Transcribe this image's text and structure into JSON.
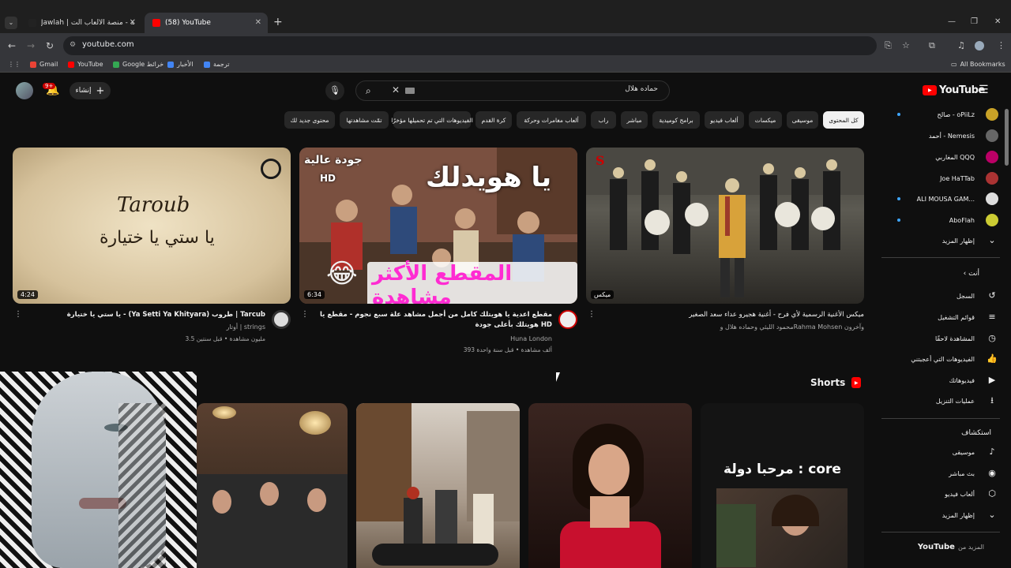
{
  "browser": {
    "tabs": [
      {
        "title": "Jawlah | جولة - منصة الألعاب الت...",
        "active": false
      },
      {
        "title": "(58) YouTube",
        "active": true
      }
    ],
    "url": "youtube.com",
    "bookmarks": [
      {
        "label": "Gmail",
        "color": "#ea4335"
      },
      {
        "label": "YouTube",
        "color": "#ff0000"
      },
      {
        "label": "Google خرائط",
        "color": "#34a853"
      },
      {
        "label": "الأخبار",
        "color": "#4285f4"
      },
      {
        "label": "ترجمة",
        "color": "#4285f4"
      }
    ],
    "all_bookmarks": "All Bookmarks"
  },
  "masthead": {
    "notification_count": "9+",
    "create_label": "إنشاء",
    "search_value": "حماده هلال",
    "logo_text": "YouTube"
  },
  "chips": [
    "كل المحتوى",
    "موسيقى",
    "ميكسات",
    "ألعاب فيديو",
    "برامج كوميدية",
    "مباشر",
    "راب",
    "ألعاب مغامرات وحركة",
    "كرة القدم",
    "الفيديوهات التي تم تحميلها مؤخرًا",
    "تمّت مشاهدتها",
    "محتوى جديد لك"
  ],
  "videos": [
    {
      "title": "ميكس الأغنية الرسمية لأي فرح - أغنية هجيرو عداء سعد الصغير",
      "channel": "محمود الليثي وحماده هلال وRahma Mohsen وآخرون",
      "meta": "",
      "duration": "ميكس",
      "thumb_caption": ""
    },
    {
      "title": "مقطع اعدية يا هويتلك كامل من أجمل مشاهد علة سبع نجوم - مقطع يا هويتلك بأعلى جودة HD",
      "channel": "Huna London",
      "meta": "393 ألف مشاهدة • قبل سنة واحدة",
      "duration": "6:34",
      "thumb_caption_top": "جودة عالية",
      "thumb_caption_hd": "HD",
      "thumb_caption_main": "يا هويدلك",
      "thumb_caption_bottom": "المقطع الأكثر مشاهدة"
    },
    {
      "title": "يا ستي يا ختيارة - (Ya Setti Ya Khityara) طروب | Tarcub",
      "channel": "أوتار | strings",
      "meta": "3.5 مليون مشاهدة • قبل سنتين",
      "duration": "4:24",
      "thumb_caption_script": "Taroub",
      "thumb_caption_arabic": "يا ستي يا ختيارة"
    }
  ],
  "shorts": {
    "heading": "Shorts",
    "items": [
      {
        "caption_top": "مرحبا دولة : core"
      },
      {
        "caption_top": ""
      },
      {
        "caption_top": ""
      },
      {
        "caption_top": ""
      }
    ]
  },
  "sidebar": {
    "subscriptions": [
      {
        "label": "صالح - oPiiLz",
        "live": true,
        "color": "#c9a227"
      },
      {
        "label": "أحمد - Nemesis",
        "live": false,
        "color": "#888"
      },
      {
        "label": "المغاربي QQQ",
        "live": false,
        "color": "#b06"
      },
      {
        "label": "Joe HaTTab",
        "live": false,
        "color": "#a33"
      },
      {
        "label": "ALI MOUSA GAM...",
        "live": true,
        "color": "#ddd"
      },
      {
        "label": "AboFlah",
        "live": true,
        "color": "#cc3"
      }
    ],
    "show_more": "إظهار المزيد",
    "you_heading": "أنت",
    "you_items": [
      {
        "label": "السجل",
        "icon": "history-icon",
        "glyph": "↺"
      },
      {
        "label": "قوائم التشغيل",
        "icon": "playlist-icon",
        "glyph": "≡"
      },
      {
        "label": "المشاهدة لاحقًا",
        "icon": "clock-icon",
        "glyph": "◷"
      },
      {
        "label": "الفيديوهات التي أعجبتني",
        "icon": "like-icon",
        "glyph": "👍"
      },
      {
        "label": "فيديوهاتك",
        "icon": "your-videos-icon",
        "glyph": "▶"
      },
      {
        "label": "عمليات التنزيل",
        "icon": "download-icon",
        "glyph": "⭳"
      }
    ],
    "explore_heading": "استكشاف",
    "explore_items": [
      {
        "label": "موسيقى",
        "icon": "music-icon",
        "glyph": "♪"
      },
      {
        "label": "بث مباشر",
        "icon": "live-icon",
        "glyph": "◉"
      },
      {
        "label": "ألعاب فيديو",
        "icon": "gaming-icon",
        "glyph": "⬡"
      },
      {
        "label": "إظهار المزيد",
        "icon": "chevron-down-icon",
        "glyph": "⌄"
      }
    ],
    "more_heading_prefix": "المزيد من",
    "more_heading_brand": "YouTube"
  }
}
